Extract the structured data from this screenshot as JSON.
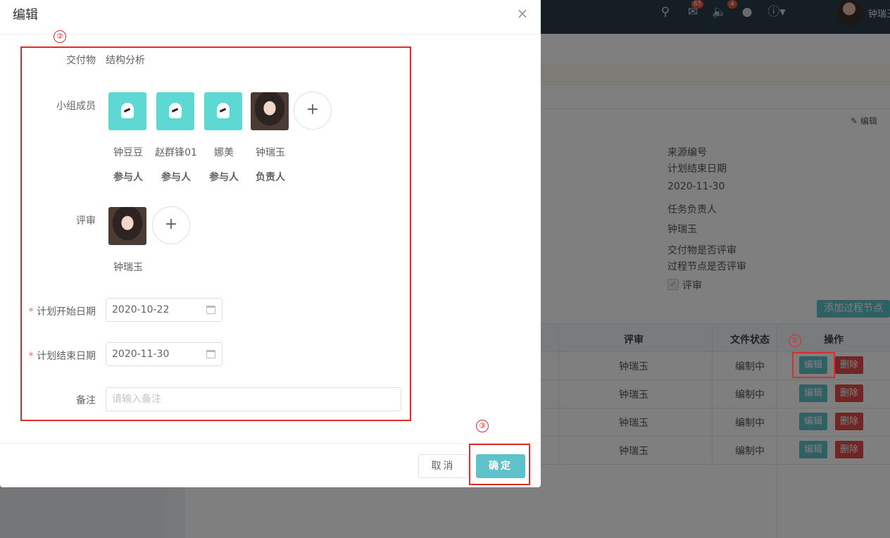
{
  "topbar": {
    "mail_badge": "65",
    "speaker_badge": "4",
    "user_name": "钟瑞玉"
  },
  "background": {
    "edit_link": "编辑",
    "info": [
      "来源编号",
      "计划结束日期",
      "2020-11-30",
      "任务负责人",
      "钟瑞玉",
      "交付物是否评审",
      "过程节点是否评审"
    ],
    "review_checkbox_label": "评审",
    "add_node_button": "添加过程节点",
    "table": {
      "headers": [
        "评审",
        "文件状态",
        "操作"
      ],
      "rows": [
        {
          "reviewer": "钟瑞玉",
          "status": "编制中"
        },
        {
          "reviewer": "钟瑞玉",
          "status": "编制中"
        },
        {
          "reviewer": "钟瑞玉",
          "status": "编制中"
        },
        {
          "reviewer": "钟瑞玉",
          "status": "编制中"
        }
      ],
      "edit_label": "编辑",
      "delete_label": "删除"
    }
  },
  "dialog": {
    "title": "编辑",
    "close_icon": "×",
    "deliverable": {
      "label": "交付物",
      "value": "结构分析"
    },
    "members": {
      "label": "小组成员",
      "items": [
        {
          "name": "钟豆豆",
          "role": "参与人"
        },
        {
          "name": "赵群锋01",
          "role": "参与人"
        },
        {
          "name": "娜美",
          "role": "参与人"
        },
        {
          "name": "钟瑞玉",
          "role": "负责人"
        }
      ],
      "add_icon": "+"
    },
    "review": {
      "label": "评审",
      "name": "钟瑞玉",
      "add_icon": "+"
    },
    "start_date": {
      "required_mark": "*",
      "label": "计划开始日期",
      "value": "2020-10-22"
    },
    "end_date": {
      "required_mark": "*",
      "label": "计划结束日期",
      "value": "2020-11-30"
    },
    "note": {
      "label": "备注",
      "placeholder": "请输入备注"
    },
    "cancel_label": "取消",
    "confirm_label": "确定"
  },
  "annotations": {
    "one": "①",
    "two": "②",
    "three": "③"
  }
}
